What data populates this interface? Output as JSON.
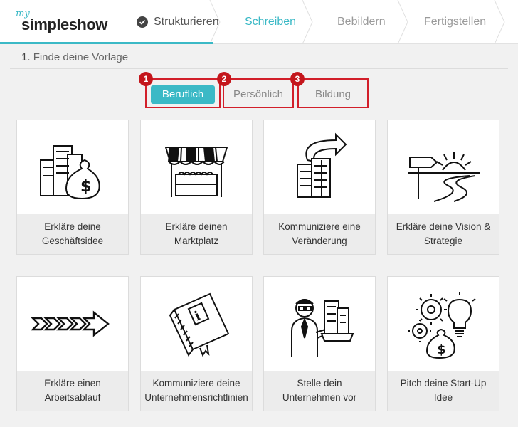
{
  "brand": {
    "prefix": "my",
    "name": "simpleshow"
  },
  "steps": [
    {
      "label": "Strukturieren",
      "state": "done"
    },
    {
      "label": "Schreiben",
      "state": "active"
    },
    {
      "label": "Bebildern",
      "state": "inactive"
    },
    {
      "label": "Fertigstellen",
      "state": "inactive"
    }
  ],
  "section": {
    "number": "1.",
    "title": "Finde deine Vorlage"
  },
  "tabs": [
    {
      "label": "Beruflich",
      "badge": "1",
      "selected": true
    },
    {
      "label": "Persönlich",
      "badge": "2",
      "selected": false
    },
    {
      "label": "Bildung",
      "badge": "3",
      "selected": false
    }
  ],
  "templates": [
    {
      "caption": "Erkläre deine Geschäftsidee",
      "icon": "office-buildings-money-bag-icon"
    },
    {
      "caption": "Erkläre deinen Marktplatz",
      "icon": "market-stall-icon"
    },
    {
      "caption": "Kommuniziere eine Veränderung",
      "icon": "building-change-arrow-icon"
    },
    {
      "caption": "Erkläre deine Vision & Strategie",
      "icon": "signpost-sunrise-road-icon"
    },
    {
      "caption": "Erkläre einen Arbeitsablauf",
      "icon": "process-chevrons-arrow-icon"
    },
    {
      "caption": "Kommuniziere deine Unternehmensrichtlinien",
      "icon": "info-handbook-icon"
    },
    {
      "caption": "Stelle dein Unternehmen vor",
      "icon": "businessman-presenting-buildings-icon"
    },
    {
      "caption": "Pitch deine Start-Up Idee",
      "icon": "gears-lightbulb-money-bag-icon"
    }
  ],
  "colors": {
    "accent": "#3bb9c6",
    "highlight": "#d21f2a",
    "badge": "#c4161c"
  }
}
